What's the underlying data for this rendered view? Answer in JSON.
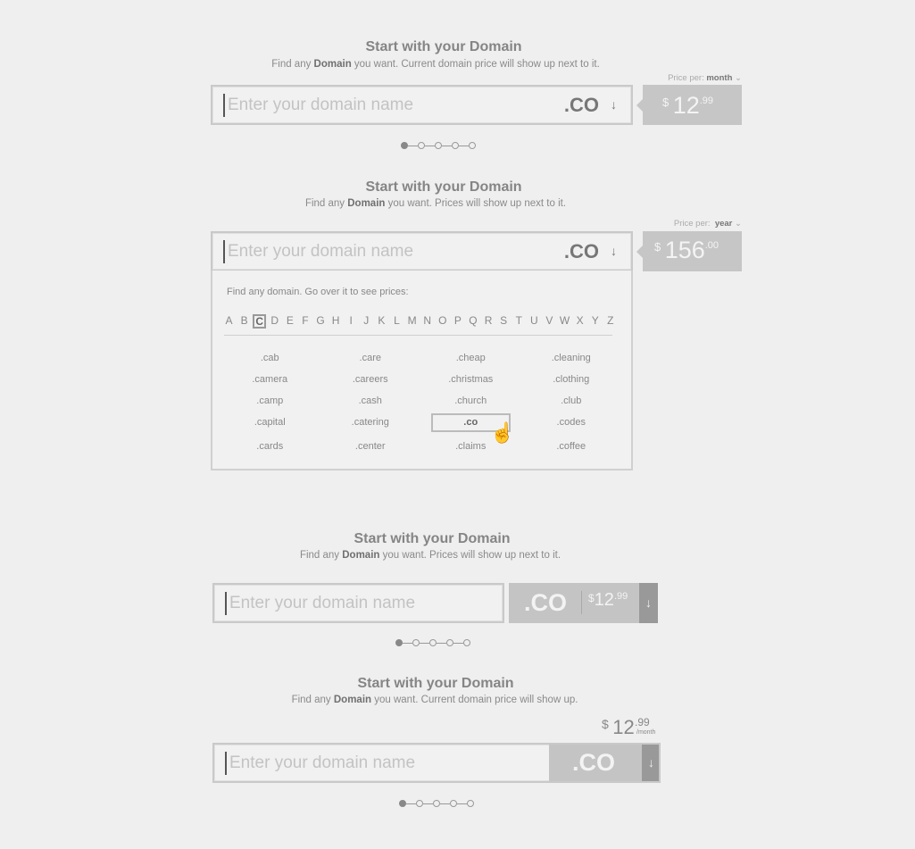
{
  "placeholder": "Enter your domain name",
  "title": "Start with your Domain",
  "tld": ".CO",
  "arrow": "↓",
  "sections": [
    {
      "sub_pre": "Find any ",
      "sub_bold": "Domain",
      "sub_post": " you want. Current domain price will show up next to it.",
      "price_per_label": "Price per:",
      "price_per_value": "month",
      "currency": "$",
      "price": "12",
      "cents": ".99",
      "step": 1,
      "steps": 5
    },
    {
      "sub_pre": "Find any ",
      "sub_bold": "Domain",
      "sub_post": " you want. Prices will show up next to it.",
      "price_per_label": "Price per:",
      "price_per_value": "year",
      "currency": "$",
      "price": "156",
      "cents": ".00",
      "dropdown": {
        "hint": "Find any domain. Go over it to see prices:",
        "letters": [
          "A",
          "B",
          "C",
          "D",
          "E",
          "F",
          "G",
          "H",
          "I",
          "J",
          "K",
          "L",
          "M",
          "N",
          "O",
          "P",
          "Q",
          "R",
          "S",
          "T",
          "U",
          "V",
          "W",
          "X",
          "Y",
          "Z"
        ],
        "selected_letter": "C",
        "domains": [
          ".cab",
          ".care",
          ".cheap",
          ".cleaning",
          ".camera",
          ".careers",
          ".christmas",
          ".clothing",
          ".camp",
          ".cash",
          ".church",
          ".club",
          ".capital",
          ".catering",
          ".co",
          ".codes",
          ".cards",
          ".center",
          ".claims",
          ".coffee"
        ],
        "hovered": ".co"
      }
    },
    {
      "sub_pre": "Find any ",
      "sub_bold": "Domain",
      "sub_post": " you want. Prices will show up next to it.",
      "currency": "$",
      "price": "12",
      "cents": ".99",
      "step": 1,
      "steps": 5
    },
    {
      "sub_pre": "Find any ",
      "sub_bold": "Domain",
      "sub_post": " you want. Current domain price will show up.",
      "currency": "$",
      "price": "12",
      "cents": ".99",
      "period": "/month",
      "step": 1,
      "steps": 5
    }
  ]
}
